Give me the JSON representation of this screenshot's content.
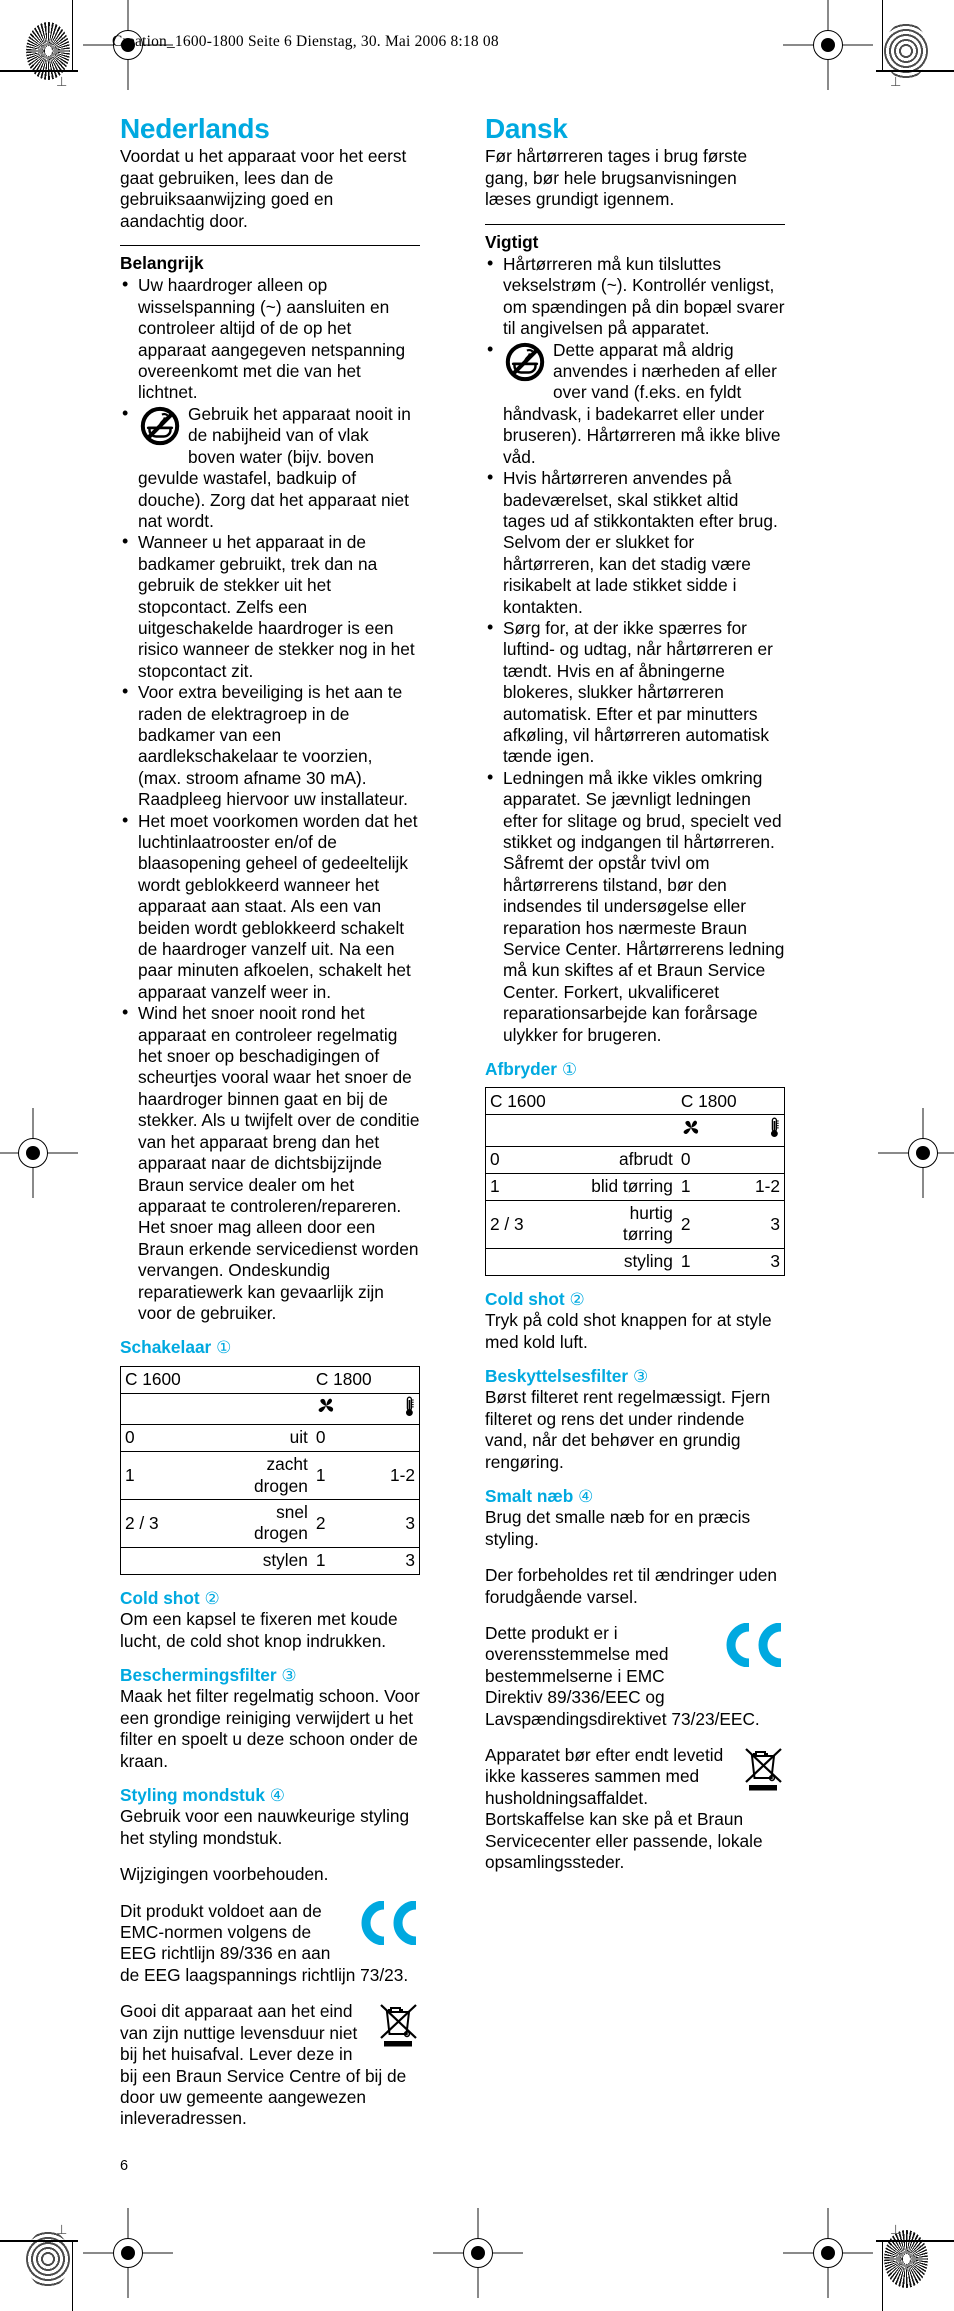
{
  "print_marks": {
    "slug_line": "Creation_1600-1800  Seite 6  Dienstag, 30. Mai 2006  8:18 08",
    "tick_glyph": "⊥"
  },
  "page_number": "6",
  "colors": {
    "heading_blue": "#00a9e0",
    "text_black": "#000000",
    "rule_black": "#000000"
  },
  "columns": {
    "left": {
      "language_title": "Nederlands",
      "intro": "Voordat u het apparaat voor het eerst gaat gebruiken, lees dan de gebruiksaanwijzing goed en aandachtig door.",
      "important_heading": "Belangrijk",
      "bullets": [
        "Uw haardroger alleen op wisselspanning (~) aansluiten en controleer altijd of de op het apparaat aangegeven netspanning overeenkomt met die van het lichtnet.",
        "Gebruik het apparaat nooit in de nabijheid van of vlak boven water (bijv. boven gevulde wastafel, badkuip of douche). Zorg dat het apparaat niet nat wordt.",
        "Wanneer u het apparaat in de badkamer gebruikt, trek dan na gebruik de stekker uit het stopcontact. Zelfs een uitgeschakelde haardroger is een risico wanneer de stekker nog in het stopcontact zit.",
        "Voor extra beveiliging is het aan te raden de elektragroep in de badkamer van een aardlekschakelaar te voorzien, (max. stroom afname 30 mA). Raadpleeg hiervoor uw installateur.",
        "Het moet voorkomen worden dat het luchtinlaatrooster en/of de blaasopening geheel of gedeeltelijk wordt geblokkeerd wanneer het apparaat aan staat. Als een van beiden wordt geblokkeerd schakelt de haardroger vanzelf uit. Na een paar minuten afkoelen, schakelt het apparaat vanzelf weer in.",
        "Wind het snoer nooit rond het apparaat en controleer regelmatig het snoer op beschadigingen of scheurtjes vooral waar het snoer de haardroger binnen gaat en bij de stekker. Als u twijfelt over de conditie van het apparaat breng dan het apparaat naar de dichtsbijzijnde Braun service dealer om het apparaat te controleren/repareren. Het snoer mag alleen door een Braun erkende servicedienst worden vervangen. Ondeskundig reparatiewerk kan gevaarlijk zijn voor de gebruiker."
      ],
      "bullet_with_icon_index": 1,
      "switch_heading": "Schakelaar",
      "switch_heading_num": "①",
      "table": {
        "model_left": "C 1600",
        "model_right": "C 1800",
        "fan_symbol": "fan-icon",
        "temp_symbol": "thermometer-icon",
        "rows": [
          {
            "left": "0",
            "desc": "uit",
            "fan": "0",
            "temp": ""
          },
          {
            "left": "1",
            "desc": "zacht drogen",
            "fan": "1",
            "temp": "1-2"
          },
          {
            "left": "2 / 3",
            "desc": "snel drogen",
            "fan": "2",
            "temp": "3"
          },
          {
            "left": "",
            "desc": "stylen",
            "fan": "1",
            "temp": "3"
          }
        ]
      },
      "sections": [
        {
          "heading": "Cold shot",
          "num": "②",
          "body": "Om een kapsel te fixeren met koude lucht, de cold shot knop indrukken."
        },
        {
          "heading": "Beschermingsfilter",
          "num": "③",
          "body": "Maak het filter regelmatig schoon. Voor een grondige reiniging verwijdert u het filter en spoelt u deze schoon onder de kraan."
        },
        {
          "heading": "Styling mondstuk",
          "num": "④",
          "body": "Gebruik voor een nauwkeurige styling het styling mondstuk."
        }
      ],
      "changes_notice": "Wijzigingen voorbehouden.",
      "emc_notice": "Dit produkt voldoet aan de EMC-normen volgens de EEG richtlijn 89/336 en aan de EEG laagspannings richtlijn 73/23.",
      "disposal_notice": "Gooi dit apparaat aan het eind van zijn nuttige levensduur niet bij het huisafval. Lever deze in bij een Braun Service Centre of bij de door uw gemeente aangewezen inleveradressen.",
      "ce_mark": "ce-mark",
      "weee_mark": "weee-crossed-bin-icon"
    },
    "right": {
      "language_title": "Dansk",
      "intro": "Før hårtørreren tages i brug første gang, bør hele brugsanvisningen læses grundigt igennem.",
      "important_heading": "Vigtigt",
      "bullets": [
        "Hårtørreren må kun tilsluttes vekselstrøm (~). Kontrollér venligst, om spændingen på din bopæl svarer til angivelsen på apparatet.",
        "Dette apparat må aldrig anvendes i nærheden af eller over vand (f.eks. en fyldt håndvask, i badekarret eller under bruseren). Hårtørreren må ikke blive våd.",
        "Hvis hårtørreren anvendes på badeværelset, skal stikket altid tages ud af stikkontakten efter brug. Selvom der er slukket for hårtørreren, kan det stadig være risikabelt at lade stikket sidde i kontakten.",
        "Sørg for, at der ikke spærres for luftind- og udtag, når hårtørreren er tændt. Hvis en af åbningerne blokeres, slukker hårtørreren automatisk. Efter et par minutters afkøling, vil hårtørreren automatisk tænde igen.",
        "Ledningen må ikke vikles omkring apparatet. Se jævnligt ledningen efter for slitage og brud, specielt ved stikket og indgangen til hårtørreren. Såfremt der opstår tvivl om hårtørrerens tilstand, bør den indsendes til undersøgelse eller reparation hos nærmeste Braun Service Center. Hårtørrerens ledning må kun skiftes af et Braun Service Center. Forkert, ukvalificeret reparationsarbejde kan forårsage ulykker for brugeren."
      ],
      "bullet_with_icon_index": 1,
      "switch_heading": "Afbryder",
      "switch_heading_num": "①",
      "table": {
        "model_left": "C 1600",
        "model_right": "C 1800",
        "fan_symbol": "fan-icon",
        "temp_symbol": "thermometer-icon",
        "rows": [
          {
            "left": "0",
            "desc": "afbrudt",
            "fan": "0",
            "temp": ""
          },
          {
            "left": "1",
            "desc": "blid tørring",
            "fan": "1",
            "temp": "1-2"
          },
          {
            "left": "2 / 3",
            "desc": "hurtig tørring",
            "fan": "2",
            "temp": "3"
          },
          {
            "left": "",
            "desc": "styling",
            "fan": "1",
            "temp": "3"
          }
        ]
      },
      "sections": [
        {
          "heading": "Cold shot",
          "num": "②",
          "body": "Tryk på cold shot knappen for at style med kold luft."
        },
        {
          "heading": "Beskyttelsesfilter",
          "num": "③",
          "body": "Børst filteret rent regelmæssigt. Fjern filteret og rens det under rindende vand, når det behøver en grundig rengøring."
        },
        {
          "heading": "Smalt næb",
          "num": "④",
          "body": "Brug det smalle næb for en præcis styling."
        }
      ],
      "changes_notice": "Der forbeholdes ret til ændringer uden forudgående varsel.",
      "emc_notice": "Dette produkt er i overensstemmelse med bestemmelserne i EMC Direktiv 89/336/EEC og Lavspændingsdirektivet 73/23/EEC.",
      "disposal_notice": "Apparatet bør efter endt levetid ikke kasseres sammen med husholdningsaffaldet. Bortskaffelse kan ske på et Braun Servicecenter eller passende, lokale opsamlingssteder.",
      "ce_mark": "ce-mark",
      "weee_mark": "weee-crossed-bin-icon"
    }
  }
}
